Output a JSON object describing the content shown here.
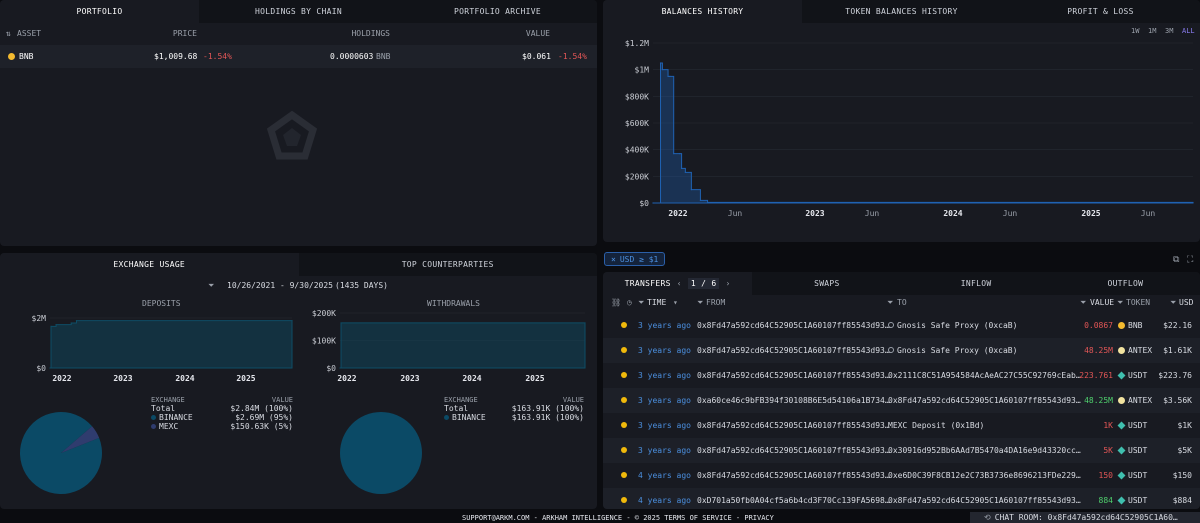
{
  "portfolio": {
    "tabs": [
      "PORTFOLIO",
      "HOLDINGS BY CHAIN",
      "PORTFOLIO ARCHIVE"
    ],
    "columns": {
      "asset": "ASSET",
      "price": "PRICE",
      "holdings": "HOLDINGS",
      "value": "VALUE"
    },
    "rows": [
      {
        "asset": "BNB",
        "price": "$1,009.68",
        "price_change": "-1.54%",
        "holdings": "0.0000603",
        "holdings_unit": "BNB",
        "value": "$0.061",
        "value_change": "-1.54%"
      }
    ]
  },
  "balances": {
    "tabs": [
      "BALANCES HISTORY",
      "TOKEN BALANCES HISTORY",
      "PROFIT & LOSS"
    ],
    "ranges": [
      "1W",
      "1M",
      "3M",
      "ALL"
    ],
    "active_range": "ALL"
  },
  "exchange": {
    "tabs": [
      "EXCHANGE USAGE",
      "TOP COUNTERPARTIES"
    ],
    "date_range": "10/26/2021 - 9/30/2025",
    "days": "(1435 DAYS)",
    "deposits": {
      "title": "DEPOSITS",
      "legend_header": {
        "exchange": "EXCHANGE",
        "value": "VALUE"
      },
      "legend": [
        {
          "name": "Total",
          "value": "$2.84M (100%)"
        },
        {
          "name": "BINANCE",
          "value": "$2.69M (95%)"
        },
        {
          "name": "MEXC",
          "value": "$150.63K (5%)"
        }
      ]
    },
    "withdrawals": {
      "title": "WITHDRAWALS",
      "legend_header": {
        "exchange": "EXCHANGE",
        "value": "VALUE"
      },
      "legend": [
        {
          "name": "Total",
          "value": "$163.91K (100%)"
        },
        {
          "name": "BINANCE",
          "value": "$163.91K (100%)"
        }
      ]
    }
  },
  "filter": {
    "label": "USD ≥ $1"
  },
  "transfers": {
    "tabs": [
      "TRANSFERS",
      "SWAPS",
      "INFLOW",
      "OUTFLOW"
    ],
    "page": "1 / 6",
    "columns": {
      "time": "TIME",
      "from": "FROM",
      "to": "TO",
      "value": "VALUE",
      "token": "TOKEN",
      "usd": "USD"
    },
    "rows": [
      {
        "time": "3 years ago",
        "from": "0x8Fd47a592cd64C52905C1A60107ff85543d93…",
        "to": "Gnosis Safe Proxy (0xcaB)",
        "value": "0.0867",
        "value_color": "neg",
        "token": "BNB",
        "usd": "$22.16"
      },
      {
        "time": "3 years ago",
        "from": "0x8Fd47a592cd64C52905C1A60107ff85543d93…",
        "to": "Gnosis Safe Proxy (0xcaB)",
        "value": "48.25M",
        "value_color": "neg",
        "token": "ANTEX",
        "usd": "$1.61K"
      },
      {
        "time": "3 years ago",
        "from": "0x8Fd47a592cd64C52905C1A60107ff85543d93…",
        "to": "0x2111C8C51A954584AcAeAC27C55C92769cEab…",
        "value": "223.761",
        "value_color": "neg",
        "token": "USDT",
        "usd": "$223.76"
      },
      {
        "time": "3 years ago",
        "from": "0xa60ce46c9bFB394f30108B6E5d54106a1B734…",
        "to": "0x8Fd47a592cd64C52905C1A60107ff85543d93…",
        "value": "48.25M",
        "value_color": "pos",
        "token": "ANTEX",
        "usd": "$3.56K"
      },
      {
        "time": "3 years ago",
        "from": "0x8Fd47a592cd64C52905C1A60107ff85543d93…",
        "to": "MEXC Deposit (0x1Bd)",
        "value": "1K",
        "value_color": "neg",
        "token": "USDT",
        "usd": "$1K"
      },
      {
        "time": "3 years ago",
        "from": "0x8Fd47a592cd64C52905C1A60107ff85543d93…",
        "to": "0x30916d952Bb6AAd7B5470a4DA16e9d43320cc…",
        "value": "5K",
        "value_color": "neg",
        "token": "USDT",
        "usd": "$5K"
      },
      {
        "time": "4 years ago",
        "from": "0x8Fd47a592cd64C52905C1A60107ff85543d93…",
        "to": "0xe6D0C39F8CB12e2C73B3736e8696213FDe229…",
        "value": "150",
        "value_color": "neg",
        "token": "USDT",
        "usd": "$150"
      },
      {
        "time": "4 years ago",
        "from": "0xD701a50fb0A04cf5a6b4cd3F70Cc139FA5698…",
        "to": "0x8Fd47a592cd64C52905C1A60107ff85543d93…",
        "value": "884",
        "value_color": "pos",
        "token": "USDT",
        "usd": "$884"
      }
    ]
  },
  "footer": {
    "text": "SUPPORT@ARKM.COM - ARKHAM INTELLIGENCE - © 2025  TERMS OF SERVICE - PRIVACY",
    "chat": "CHAT ROOM: 0x8Fd47a592cd64C52905C1A60…"
  },
  "colors": {
    "accent": "#4b8fdf",
    "negative": "#e25656",
    "positive": "#4fcf6d",
    "chart_line": "#1f62b3",
    "pie": "#0b4a66",
    "panel": "#181a21"
  },
  "chart_data": [
    {
      "type": "area",
      "name": "balances_history",
      "y_ticks": [
        "$0",
        "$200K",
        "$400K",
        "$600K",
        "$800K",
        "$1M",
        "$1.2M"
      ],
      "x_ticks": [
        "2022",
        "Jun",
        "2023",
        "Jun",
        "2024",
        "Jun",
        "2025",
        "Jun"
      ],
      "ylim": [
        0,
        1200000
      ],
      "x": [
        "2021-10-26",
        "2021-11-15",
        "2021-11-20",
        "2021-12-05",
        "2021-12-10",
        "2021-12-20",
        "2022-01-05",
        "2022-01-10",
        "2022-01-20",
        "2022-02-05",
        "2022-03-01",
        "2022-03-20",
        "2025-09-30"
      ],
      "y": [
        0,
        1050000,
        1000000,
        950000,
        950000,
        370000,
        370000,
        260000,
        230000,
        100000,
        20000,
        5000,
        2000
      ]
    },
    {
      "type": "area",
      "name": "deposits",
      "title": "DEPOSITS",
      "y_ticks": [
        "$0",
        "$2M"
      ],
      "x_ticks": [
        "2022",
        "2023",
        "2024",
        "2025"
      ],
      "ylim": [
        0,
        3000000
      ],
      "x": [
        "2021-10-26",
        "2021-11-01",
        "2021-12-01",
        "2022-03-01",
        "2022-04-01",
        "2025-09-30"
      ],
      "y": [
        0,
        2500000,
        2600000,
        2700000,
        2840000,
        2840000
      ]
    },
    {
      "type": "area",
      "name": "withdrawals",
      "title": "WITHDRAWALS",
      "y_ticks": [
        "$0",
        "$100K",
        "$200K"
      ],
      "x_ticks": [
        "2022",
        "2023",
        "2024",
        "2025"
      ],
      "ylim": [
        0,
        200000
      ],
      "x": [
        "2021-10-26",
        "2021-11-01",
        "2025-09-30"
      ],
      "y": [
        0,
        163910,
        163910
      ]
    },
    {
      "type": "pie",
      "name": "deposits_pie",
      "labels": [
        "BINANCE",
        "MEXC"
      ],
      "values": [
        2690000,
        150630
      ]
    },
    {
      "type": "pie",
      "name": "withdrawals_pie",
      "labels": [
        "BINANCE"
      ],
      "values": [
        163910
      ]
    }
  ]
}
